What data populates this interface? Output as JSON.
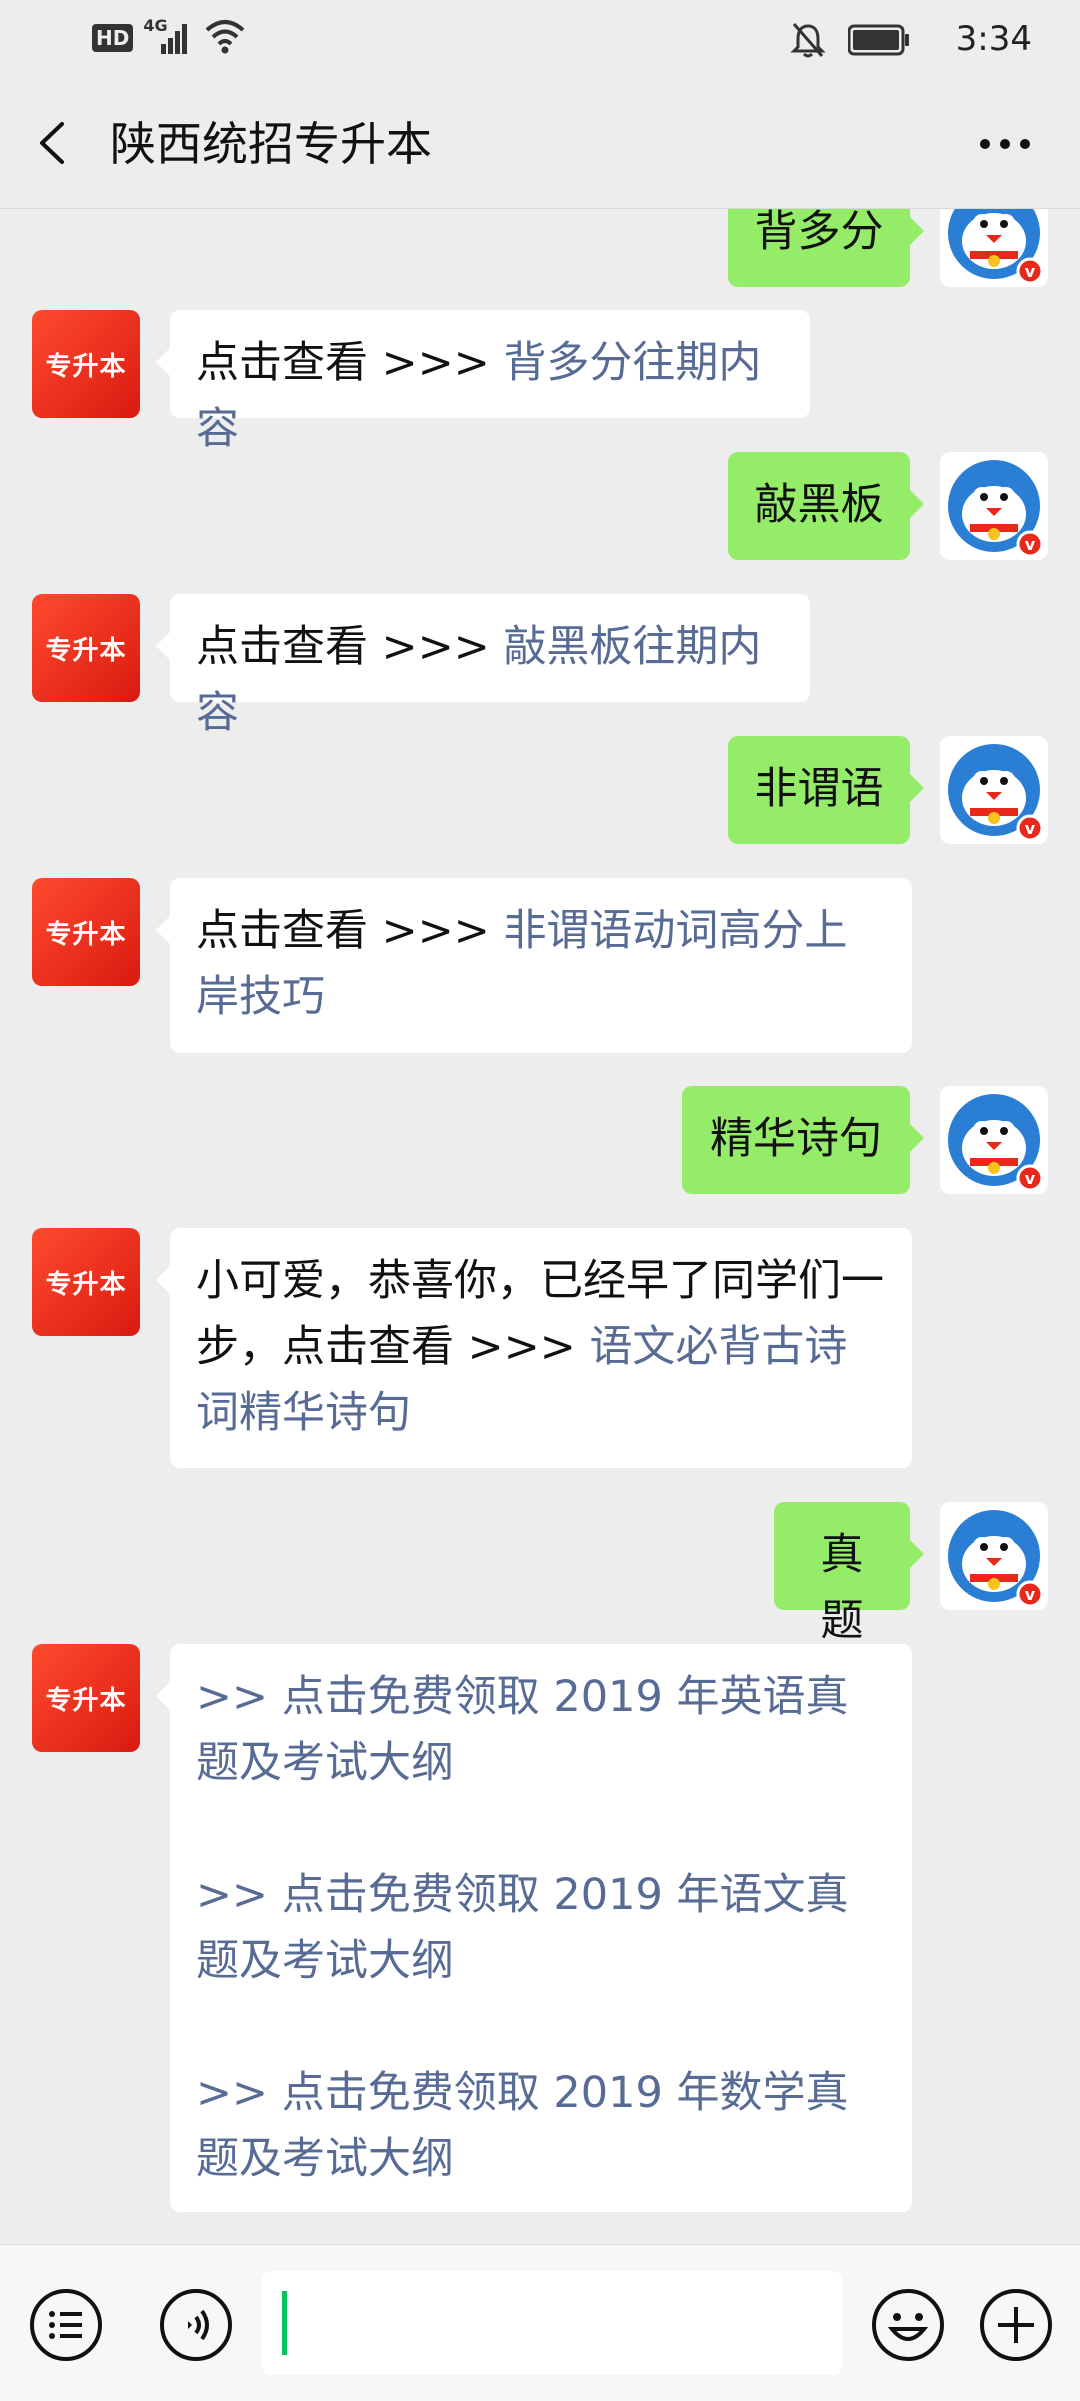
{
  "status_bar": {
    "hd": "HD",
    "network": "4G",
    "time": "3:34"
  },
  "header": {
    "title": "陕西统招专升本"
  },
  "accent_colors": {
    "link": "#576b95",
    "sent_bubble": "#95ec69",
    "avatar_brand": "#e8281a"
  },
  "account_avatar_label": "专升本",
  "messages": [
    {
      "side": "right",
      "text": "背多分"
    },
    {
      "side": "left",
      "plain": "点击查看 >>> ",
      "link": "背多分往期内容"
    },
    {
      "side": "right",
      "text": "敲黑板"
    },
    {
      "side": "left",
      "plain": "点击查看 >>> ",
      "link": "敲黑板往期内容"
    },
    {
      "side": "right",
      "text": "非谓语"
    },
    {
      "side": "left",
      "plain": "点击查看 >>> ",
      "link": "非谓语动词高分上岸技巧"
    },
    {
      "side": "right",
      "text": "精华诗句"
    },
    {
      "side": "left",
      "plain": "小可爱，恭喜你，已经早了同学们一步，点击查看 >>> ",
      "link": "语文必背古诗词精华诗句"
    },
    {
      "side": "right",
      "text": "真题"
    },
    {
      "side": "left",
      "links": [
        ">> 点击免费领取 2019 年英语真题及考试大纲",
        ">> 点击免费领取 2019 年语文真题及考试大纲",
        ">> 点击免费领取 2019 年数学真题及考试大纲"
      ]
    }
  ],
  "input": {
    "value": "",
    "placeholder": ""
  },
  "icons": {
    "back": "chevron-left-icon",
    "more": "more-dots-icon",
    "menu": "menu-list-icon",
    "voice": "voice-icon",
    "emoji": "emoji-icon",
    "plus": "plus-icon"
  }
}
